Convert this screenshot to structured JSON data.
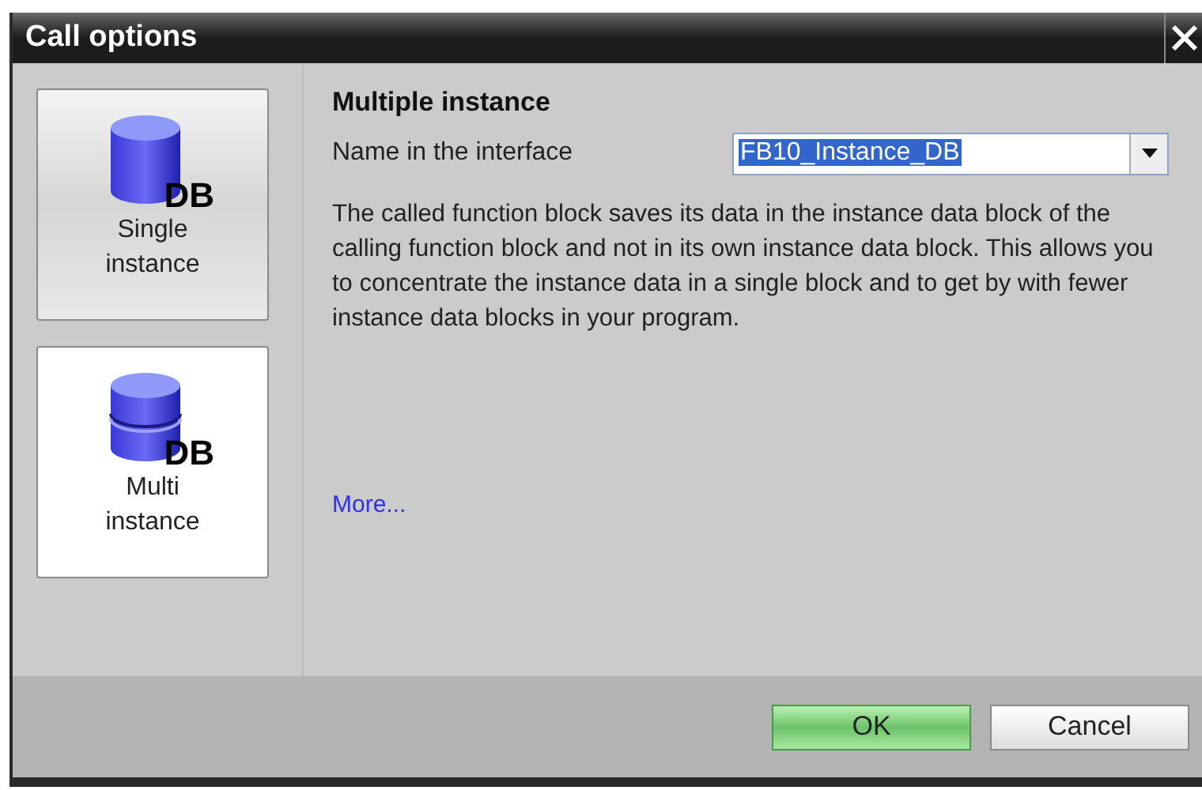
{
  "window": {
    "title": "Call options"
  },
  "options": [
    {
      "label": "Single\ninstance",
      "kind": "single",
      "badge": "DB",
      "selected": false
    },
    {
      "label": "Multi\ninstance",
      "kind": "multi",
      "badge": "DB",
      "selected": true
    }
  ],
  "panel": {
    "heading": "Multiple instance",
    "name_label": "Name in the interface",
    "name_value": "FB10_Instance_DB",
    "description": "The called function block saves its data in the instance data block of the calling function block and not in its own instance data block. This allows you to concentrate the instance data in a single block and to get by with fewer instance data blocks in your program.",
    "more_link": "More..."
  },
  "buttons": [
    {
      "label": "OK",
      "kind": "primary"
    },
    {
      "label": "Cancel",
      "kind": "secondary"
    }
  ]
}
